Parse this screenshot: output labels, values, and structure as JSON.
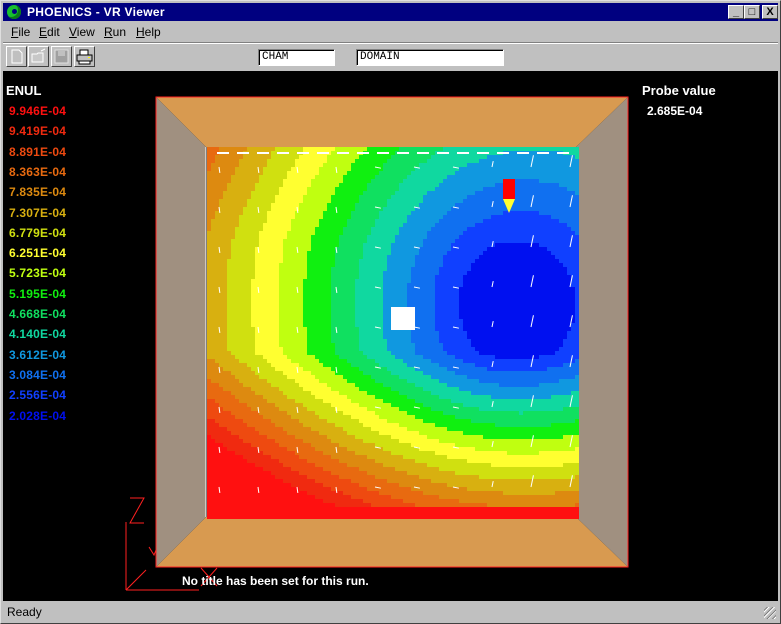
{
  "window": {
    "title": "PHOENICS - VR Viewer",
    "controls": {
      "minimize": "_",
      "maximize": "□",
      "close": "X"
    }
  },
  "menu": [
    {
      "label": "File",
      "accel": "F"
    },
    {
      "label": "Edit",
      "accel": "E"
    },
    {
      "label": "View",
      "accel": "V"
    },
    {
      "label": "Run",
      "accel": "R"
    },
    {
      "label": "Help",
      "accel": "H"
    }
  ],
  "toolbar": {
    "buttons": [
      {
        "name": "new-file-icon"
      },
      {
        "name": "open-folder-icon"
      },
      {
        "name": "save-disk-icon"
      },
      {
        "name": "print-icon"
      }
    ],
    "field_left": "CHAM",
    "field_right": "DOMAIN"
  },
  "legend": {
    "variable": "ENUL",
    "items": [
      {
        "value": "9.946E-04",
        "color": "#ff1010"
      },
      {
        "value": "9.419E-04",
        "color": "#f02a10"
      },
      {
        "value": "8.891E-04",
        "color": "#ee4a10"
      },
      {
        "value": "8.363E-04",
        "color": "#e86a10"
      },
      {
        "value": "7.835E-04",
        "color": "#dd8a10"
      },
      {
        "value": "7.307E-04",
        "color": "#d8b010"
      },
      {
        "value": "6.779E-04",
        "color": "#d0e010"
      },
      {
        "value": "6.251E-04",
        "color": "#ffff30"
      },
      {
        "value": "5.723E-04",
        "color": "#c0ff10"
      },
      {
        "value": "5.195E-04",
        "color": "#10f010"
      },
      {
        "value": "4.668E-04",
        "color": "#10e060"
      },
      {
        "value": "4.140E-04",
        "color": "#10d8a0"
      },
      {
        "value": "3.612E-04",
        "color": "#1098e0"
      },
      {
        "value": "3.084E-04",
        "color": "#1070f0"
      },
      {
        "value": "2.556E-04",
        "color": "#1040ff"
      },
      {
        "value": "2.028E-04",
        "color": "#0010f0"
      }
    ]
  },
  "probe": {
    "label": "Probe value",
    "value": "2.685E-04"
  },
  "run_title": "No title has been set for this run.",
  "axes": {
    "z": "Z",
    "y": "Y",
    "x": "X"
  },
  "status": {
    "text": "Ready"
  },
  "colors": {
    "floor": "#d89a50",
    "wall": "#a09080",
    "outline": "#ff2020",
    "title_bar": "#000080"
  }
}
